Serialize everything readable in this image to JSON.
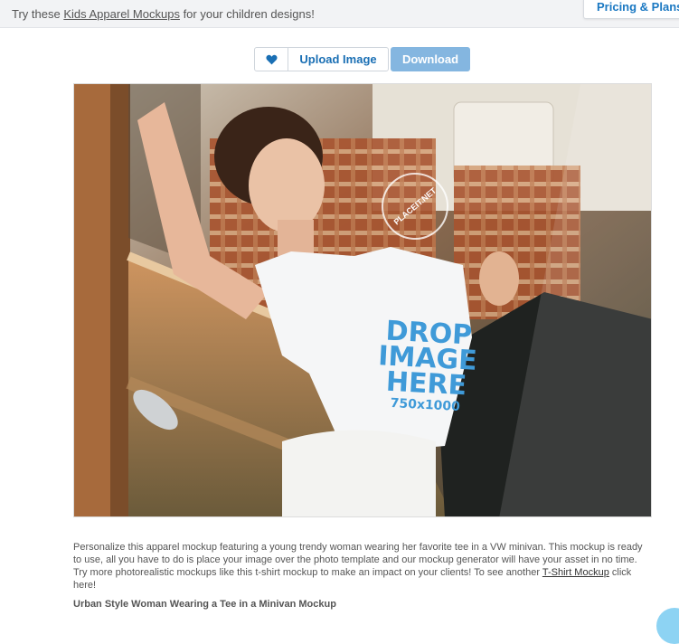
{
  "topbar": {
    "promo_prefix": "Try these ",
    "promo_link": "Kids Apparel Mockups",
    "promo_suffix": " for your children designs!",
    "pricing_label": "Pricing & Plans"
  },
  "actions": {
    "favorite_icon": "heart-icon",
    "upload_label": "Upload Image",
    "download_label": "Download",
    "accent_color": "#1a6fb4",
    "download_bg": "#84b6e0"
  },
  "mockup": {
    "drop_line1": "DROP",
    "drop_line2": "IMAGE",
    "drop_line3": "HERE",
    "drop_size": "750x1000",
    "watermark_text": "PLACEIT.NET"
  },
  "description": {
    "text": "Personalize this apparel mockup featuring a young trendy woman wearing her favorite tee in a VW minivan. This mockup is ready to use, all you have to do is place your image over the photo template and our mockup generator will have your asset in no time. Try more photorealistic mockups like this t-shirt mockup to make an impact on your clients! To see another ",
    "link": "T-Shirt Mockup",
    "suffix": " click here!",
    "caption": "Urban Style Woman Wearing a Tee in a Minivan Mockup"
  }
}
